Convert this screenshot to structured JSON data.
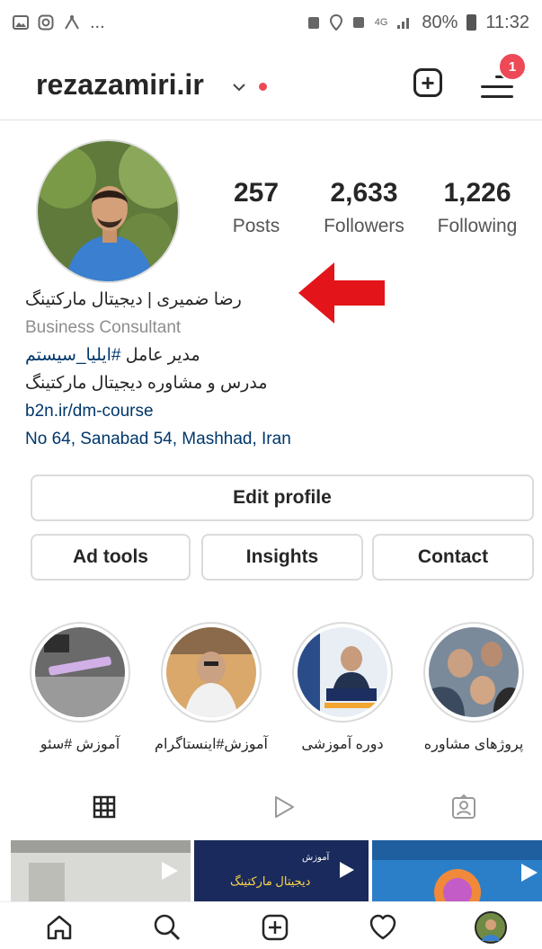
{
  "status_bar": {
    "left_icons": [
      "image-icon",
      "instagram-icon",
      "app-icon"
    ],
    "ellipsis": "...",
    "network": "4G",
    "battery_percent": "80%",
    "time": "11:32"
  },
  "header": {
    "username": "rezazamiri.ir",
    "notification_count": "1"
  },
  "profile": {
    "stats": [
      {
        "value": "257",
        "label": "Posts"
      },
      {
        "value": "2,633",
        "label": "Followers"
      },
      {
        "value": "1,226",
        "label": "Following"
      }
    ],
    "bio": {
      "name": "رضا ضمیری | دیجیتال مارکتینگ",
      "category": "Business Consultant",
      "line1_prefix": "مدیر عامل ",
      "line1_hashtag": "#ایلیا_سیستم",
      "line2": "مدرس و مشاوره دیجیتال مارکتینگ",
      "link": "b2n.ir/dm-course",
      "address": "No 64, Sanabad 54, Mashhad, Iran"
    }
  },
  "buttons": {
    "edit_profile": "Edit profile",
    "ad_tools": "Ad tools",
    "insights": "Insights",
    "contact": "Contact"
  },
  "highlights": [
    {
      "label": "آموزش #سئو"
    },
    {
      "label": "آموزش#اینستاگرام"
    },
    {
      "label": "دوره آموزشی"
    },
    {
      "label": "پروژهای مشاوره"
    }
  ],
  "tabs": [
    "grid-icon",
    "reels-icon",
    "tagged-icon"
  ],
  "posts_preview": {
    "post2_title": "آموزش",
    "post2_subtitle": "دیجیتال مارکتینگ"
  },
  "nav": [
    "home-icon",
    "search-icon",
    "create-icon",
    "activity-icon",
    "profile-avatar"
  ],
  "colors": {
    "accent_red": "#ed4956",
    "link_blue": "#00376b",
    "arrow_red": "#e3151a"
  }
}
